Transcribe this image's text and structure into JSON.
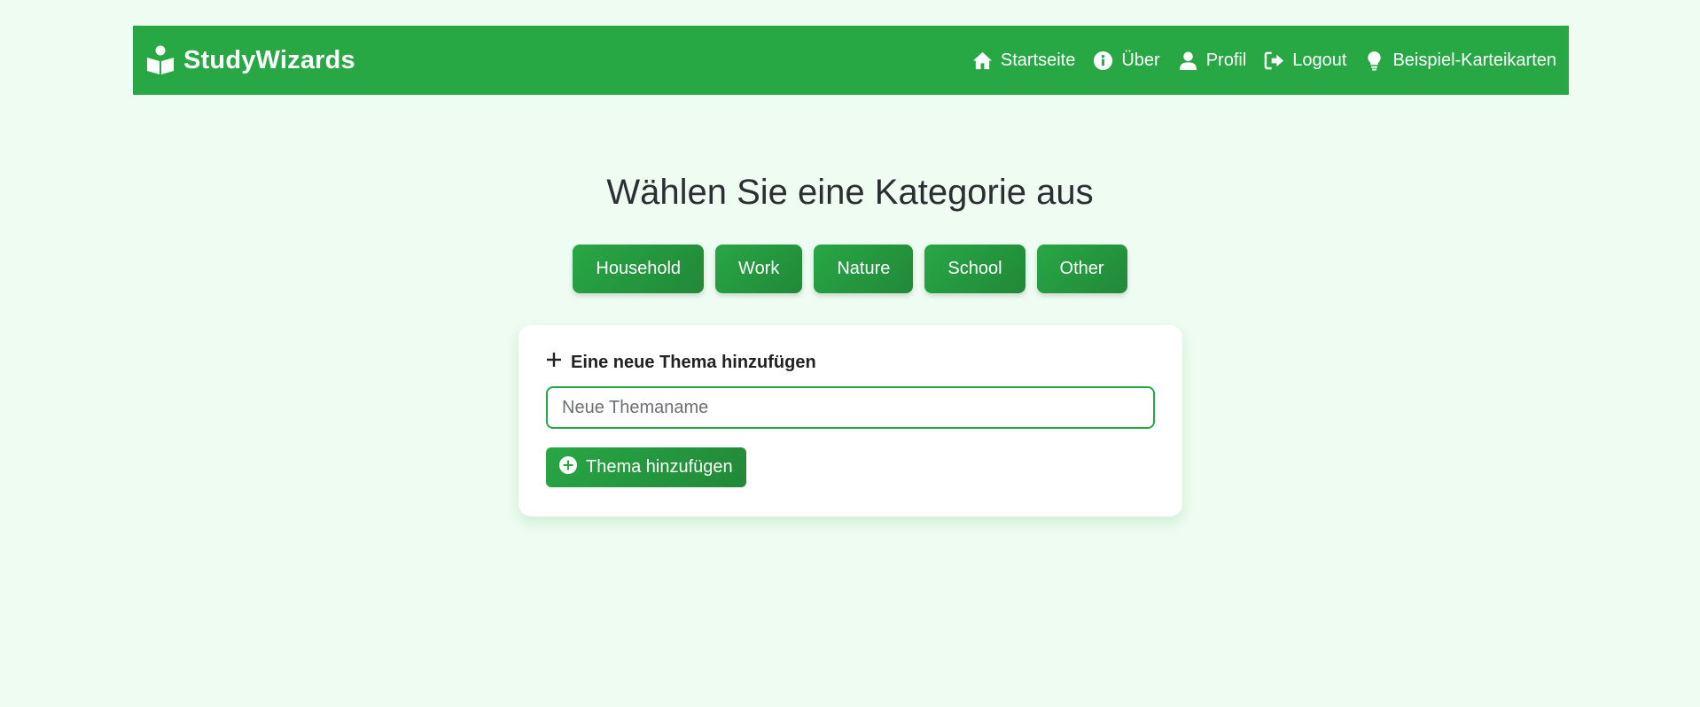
{
  "brand": {
    "name": "StudyWizards",
    "icon": "book-reader-icon"
  },
  "nav": {
    "items": [
      {
        "label": "Startseite",
        "icon": "home-icon"
      },
      {
        "label": "Über",
        "icon": "info-icon"
      },
      {
        "label": "Profil",
        "icon": "user-icon"
      },
      {
        "label": "Logout",
        "icon": "logout-icon"
      },
      {
        "label": "Beispiel-Karteikarten",
        "icon": "lightbulb-icon"
      }
    ]
  },
  "main": {
    "title": "Wählen Sie eine Kategorie aus",
    "categories": [
      "Household",
      "Work",
      "Nature",
      "School",
      "Other"
    ]
  },
  "add_topic": {
    "heading": "Eine neue Thema hinzufügen",
    "input_placeholder": "Neue Themaname",
    "input_value": "",
    "button_label": "Thema hinzufügen"
  },
  "colors": {
    "primary": "#28a745",
    "primary_dark": "#218838",
    "background": "#effcf2",
    "card": "#ffffff",
    "text": "#2b2f33"
  }
}
